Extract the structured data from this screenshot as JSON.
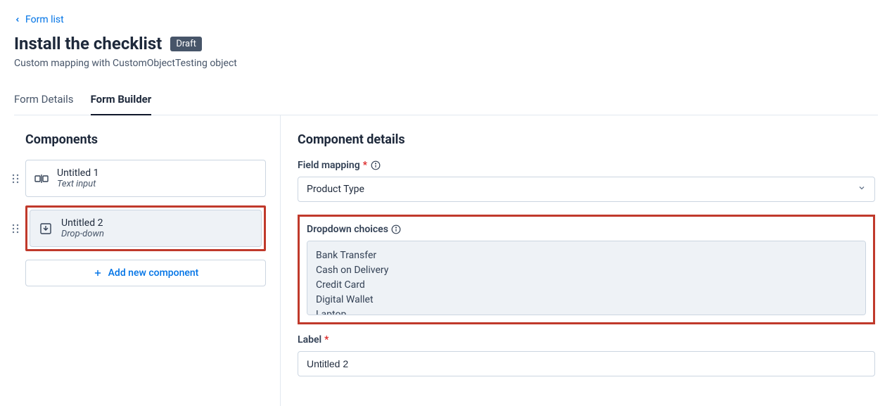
{
  "breadcrumb": {
    "label": "Form list"
  },
  "page": {
    "title": "Install the checklist",
    "badge": "Draft",
    "subtitle": "Custom mapping with CustomObjectTesting object"
  },
  "tabs": {
    "details": "Form Details",
    "builder": "Form Builder"
  },
  "sidebar": {
    "title": "Components",
    "items": [
      {
        "title": "Untitled 1",
        "type": "Text input"
      },
      {
        "title": "Untitled 2",
        "type": "Drop-down"
      }
    ],
    "add_label": "Add new component"
  },
  "details": {
    "title": "Component details",
    "field_mapping": {
      "label": "Field mapping",
      "value": "Product Type"
    },
    "dropdown_choices": {
      "label": "Dropdown choices",
      "value": "Bank Transfer\nCash on Delivery\nCredit Card\nDigital Wallet\nLaptop"
    },
    "label_field": {
      "label": "Label",
      "value": "Untitled 2"
    }
  }
}
